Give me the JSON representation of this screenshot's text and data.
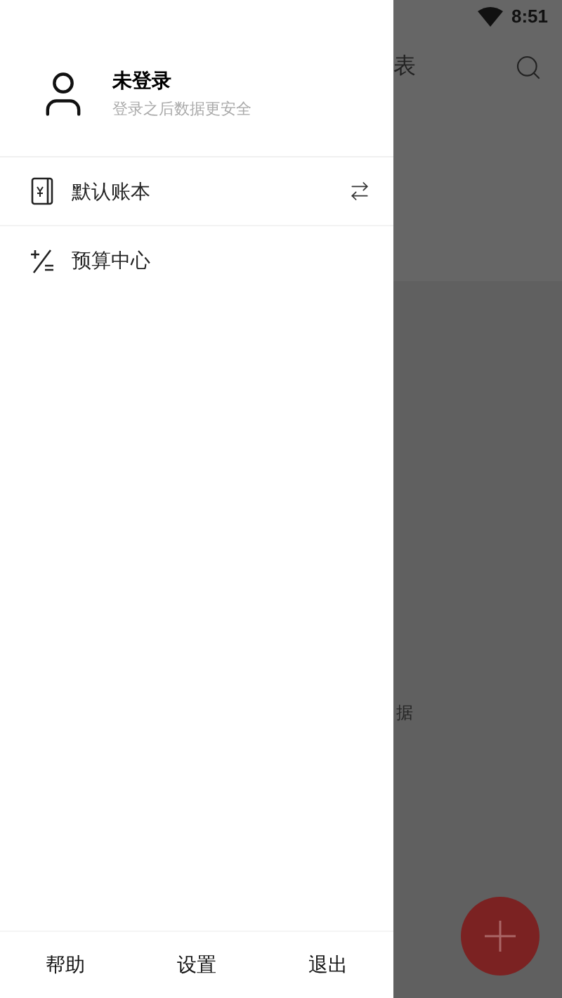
{
  "status_bar": {
    "time": "8:51"
  },
  "background": {
    "title_fragment": "表",
    "empty_fragment": "据"
  },
  "drawer": {
    "user": {
      "name": "未登录",
      "subtitle": "登录之后数据更安全"
    },
    "items": [
      {
        "kind": "ledger",
        "label": "默认账本",
        "switchable": true
      },
      {
        "kind": "budget",
        "label": "预算中心",
        "switchable": false
      }
    ],
    "footer": [
      "帮助",
      "设置",
      "退出"
    ]
  }
}
